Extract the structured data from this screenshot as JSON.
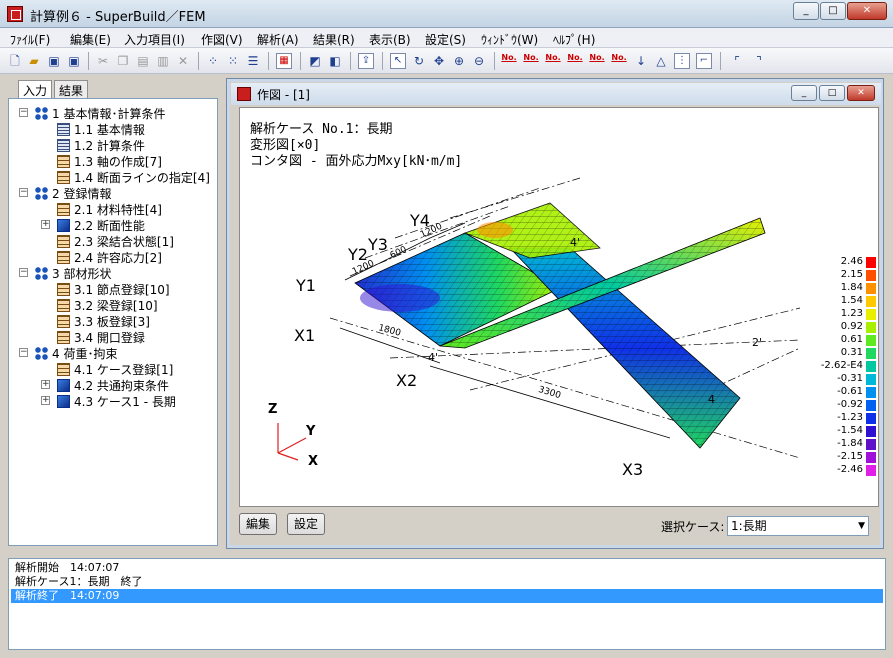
{
  "window": {
    "title": "計算例６ - SuperBuild／FEM",
    "controls": {
      "minimize": "_",
      "maximize": "□",
      "close": "✕"
    }
  },
  "menu": [
    "ﾌｧｲﾙ(F)",
    "編集(E)",
    "入力項目(I)",
    "作図(V)",
    "解析(A)",
    "結果(R)",
    "表示(B)",
    "設定(S)",
    "ｳｨﾝﾄﾞｳ(W)",
    "ﾍﾙﾌﾟ(H)"
  ],
  "toolbar": {
    "icons": [
      "new-file-icon",
      "open-folder-icon",
      "save-icon",
      "save-all-icon",
      "cut-icon",
      "copy-icon",
      "paste-icon",
      "paste-special-icon",
      "delete-icon",
      "grid-small-icon",
      "grid-large-icon",
      "table-icon",
      "frame-icon",
      "perspective-icon",
      "box-3d-icon",
      "export-icon",
      "select-icon",
      "rotate-icon",
      "pan-icon",
      "zoom-in-icon",
      "zoom-out-icon",
      "node-number-icon",
      "member-number-icon",
      "section-number-icon",
      "element-number-icon",
      "plate-number-icon",
      "opening-number-icon",
      "load-arrow-icon",
      "support-icon",
      "dimension-icon",
      "spring-icon",
      "beam-end-icon"
    ],
    "number_label": "No."
  },
  "left": {
    "tabs": [
      "入力",
      "結果"
    ],
    "tree": [
      {
        "label": "1 基本情報･計算条件",
        "level": 0,
        "icon": "group-icon",
        "expander": "−"
      },
      {
        "label": "1.1 基本情報",
        "level": 1,
        "icon": "document-icon"
      },
      {
        "label": "1.2 計算条件",
        "level": 1,
        "icon": "document-icon"
      },
      {
        "label": "1.3 軸の作成[7]",
        "level": 1,
        "icon": "table-icon"
      },
      {
        "label": "1.4 断面ラインの指定[4]",
        "level": 1,
        "icon": "table-icon"
      },
      {
        "label": "2 登録情報",
        "level": 0,
        "icon": "group-icon",
        "expander": "−"
      },
      {
        "label": "2.1 材料特性[4]",
        "level": 1,
        "icon": "table-icon"
      },
      {
        "label": "2.2 断面性能",
        "level": 1,
        "icon": "blue-icon",
        "expander": "+"
      },
      {
        "label": "2.3 梁結合状態[1]",
        "level": 1,
        "icon": "table-icon"
      },
      {
        "label": "2.4 許容応力[2]",
        "level": 1,
        "icon": "table-icon"
      },
      {
        "label": "3 部材形状",
        "level": 0,
        "icon": "group-icon",
        "expander": "−"
      },
      {
        "label": "3.1 節点登録[10]",
        "level": 1,
        "icon": "table-icon"
      },
      {
        "label": "3.2 梁登録[10]",
        "level": 1,
        "icon": "table-icon"
      },
      {
        "label": "3.3 板登録[3]",
        "level": 1,
        "icon": "table-icon"
      },
      {
        "label": "3.4 開口登録",
        "level": 1,
        "icon": "table-icon"
      },
      {
        "label": "4 荷重･拘束",
        "level": 0,
        "icon": "group-icon",
        "expander": "−"
      },
      {
        "label": "4.1 ケース登録[1]",
        "level": 1,
        "icon": "table-icon"
      },
      {
        "label": "4.2 共通拘束条件",
        "level": 1,
        "icon": "blue-icon",
        "expander": "+"
      },
      {
        "label": "4.3 ケース1 - 長期",
        "level": 1,
        "icon": "blue-icon",
        "expander": "+"
      }
    ]
  },
  "child": {
    "title": "作図 - [1]",
    "caption": [
      "解析ケース No.1：長期",
      "変形図[×0]",
      "コンタ図 - 面外応力Mxy[kN･m/m]"
    ],
    "legend": {
      "values": [
        "2.46",
        "2.15",
        "1.84",
        "1.54",
        "1.23",
        "0.92",
        "0.61",
        "0.31",
        "-2.62-E4",
        "-0.31",
        "-0.61",
        "-0.92",
        "-1.23",
        "-1.54",
        "-1.84",
        "-2.15",
        "-2.46"
      ],
      "colors": [
        "#ff0000",
        "#ff5000",
        "#ff9000",
        "#ffc800",
        "#e8f000",
        "#a8f000",
        "#60e820",
        "#20d860",
        "#00c8a0",
        "#00b8d8",
        "#0090f0",
        "#0060f0",
        "#1030e8",
        "#3010d0",
        "#6010c8",
        "#a010d8",
        "#e020e8"
      ]
    },
    "axes_labels": {
      "x1": "X1",
      "x2": "X2",
      "x3": "X3",
      "y1": "Y1",
      "y2": "Y2",
      "y3": "Y3",
      "y4": "Y4"
    },
    "dimensions": {
      "d1800": "1800",
      "d3300": "3300",
      "d1200a": "1200",
      "d1200b": "1200",
      "d600": "600",
      "tick4a": "4'",
      "tick4b": "4'",
      "tick2": "2'",
      "tick4c": "4"
    },
    "triad": {
      "z": "Z",
      "y": "Y",
      "x": "X"
    },
    "buttons": {
      "edit": "編集",
      "settings": "設定"
    },
    "case_label": "選択ケース:",
    "case_value": "1:長期"
  },
  "log": [
    {
      "text": "解析開始　14:07:07",
      "selected": false
    },
    {
      "text": "解析ケース1：長期　終了",
      "selected": false
    },
    {
      "text": "解析終了　14:07:09",
      "selected": true
    }
  ]
}
